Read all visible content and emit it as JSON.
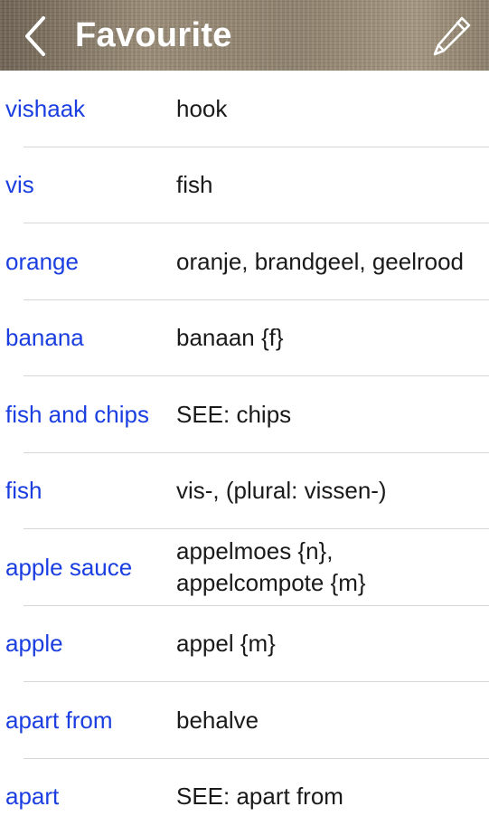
{
  "header": {
    "title": "Favourite",
    "back_icon": "chevron-left-icon",
    "edit_icon": "pencil-icon",
    "text_color": "#ffffff"
  },
  "colors": {
    "term": "#1a3ee0",
    "translation": "#1a1a1a",
    "separator": "#d6d6d6"
  },
  "favourites": [
    {
      "term": "vishaak",
      "translation": "hook"
    },
    {
      "term": "vis",
      "translation": "fish"
    },
    {
      "term": "orange",
      "translation": "oranje, brandgeel, geelrood"
    },
    {
      "term": "banana",
      "translation": "banaan {f}"
    },
    {
      "term": "fish and chips",
      "translation": "SEE: chips"
    },
    {
      "term": "fish",
      "translation": "vis-, (plural: vissen-)"
    },
    {
      "term": "apple sauce",
      "translation": "appelmoes {n}, appelcompote {m}"
    },
    {
      "term": "apple",
      "translation": "appel {m}"
    },
    {
      "term": "apart from",
      "translation": "behalve"
    },
    {
      "term": "apart",
      "translation": "SEE: apart from"
    }
  ]
}
